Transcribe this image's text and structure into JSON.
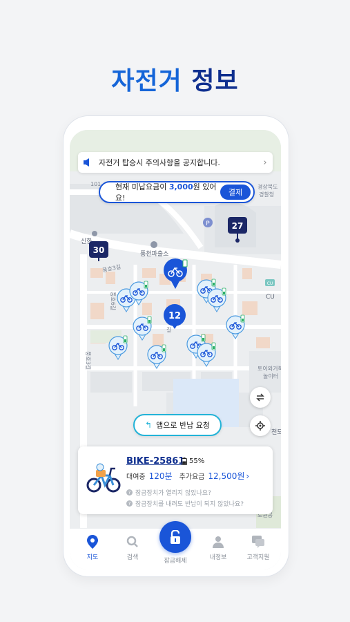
{
  "header": {
    "title_accent": "자전거",
    "title_rest": " 정보"
  },
  "notice": {
    "text": "자전거 탑승시 주의사항을 공지합니다.",
    "chevron": "›"
  },
  "unpaid": {
    "prefix": "현재 미납요금이 ",
    "amount": "3,000",
    "suffix": "원 있어요!",
    "pay_label": "결제"
  },
  "map_labels": {
    "road_num": "101",
    "gov_office_1": "경상북도",
    "gov_office_2": "경찰청",
    "shinhan": "신한",
    "police_box": "풍천파출소",
    "street_1": "풍호3길",
    "street_2": "풍호6길",
    "street_3": "풍호3길",
    "store": "CU",
    "store_badge": "CU",
    "playground_1": "토이와거북",
    "playground_2": "놀이터",
    "right_cut": "천도",
    "park_cut": "도원공",
    "small_road": "길",
    "parking": "P"
  },
  "clusters": [
    "30",
    "27",
    "12"
  ],
  "return_button": {
    "icon": "↰",
    "label": "앱으로 반납 요청"
  },
  "bike_card": {
    "bike_id": "BIKE-25861",
    "battery": "55%",
    "rent_label": "대여중",
    "rent_time": "120분",
    "fee_label": "추가요금",
    "fee_value": "12,500원",
    "fee_chevron": "›",
    "faq_1": "잠금장치가 열리지 않았나요?",
    "faq_2": "잠금장치를 내려도 반납이 되지 않았나요?",
    "faq_icon": "?"
  },
  "tabs": {
    "map": "지도",
    "search": "검색",
    "unlock": "잠금해제",
    "my_info": "내정보",
    "support": "고객지원"
  },
  "colors": {
    "brand_dark": "#0f2f8f",
    "brand": "#1a55d8",
    "accent_cyan": "#22b3d8",
    "marker_light": "#e3f1fb"
  }
}
